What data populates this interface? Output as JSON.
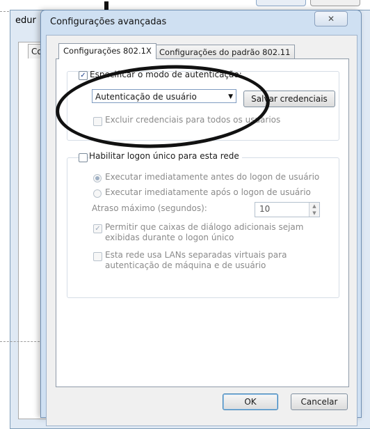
{
  "background_window": {
    "title": "edur",
    "tab_label": "Co"
  },
  "dialog": {
    "title": "Configurações avançadas",
    "close_glyph": "✕",
    "tabs": [
      {
        "label": "Configurações 802.1X",
        "active": true
      },
      {
        "label": "Configurações do padrão 802.11",
        "active": false
      }
    ],
    "auth": {
      "specify_label": "Especificar o modo de autenticação:",
      "specify_checked": true,
      "mode_value": "Autenticação de usuário",
      "save_credentials": "Salvar credenciais",
      "delete_label": "Excluir credenciais para todos os usuários"
    },
    "sso": {
      "enable_label": "Habilitar logon único para esta rede",
      "enable_checked": false,
      "radio_before": "Executar imediatamente antes do logon de usuário",
      "radio_after": "Executar imediatamente após o logon de usuário",
      "delay_label": "Atraso máximo (segundos):",
      "delay_value": "10",
      "allow_dialogs": "Permitir que caixas de diálogo adicionais sejam exibidas durante o logon único",
      "vlan_label": "Esta rede usa LANs separadas virtuais para autenticação de máquina e de usuário"
    },
    "ok_label": "OK",
    "cancel_label": "Cancelar"
  },
  "check_glyph": "✓"
}
